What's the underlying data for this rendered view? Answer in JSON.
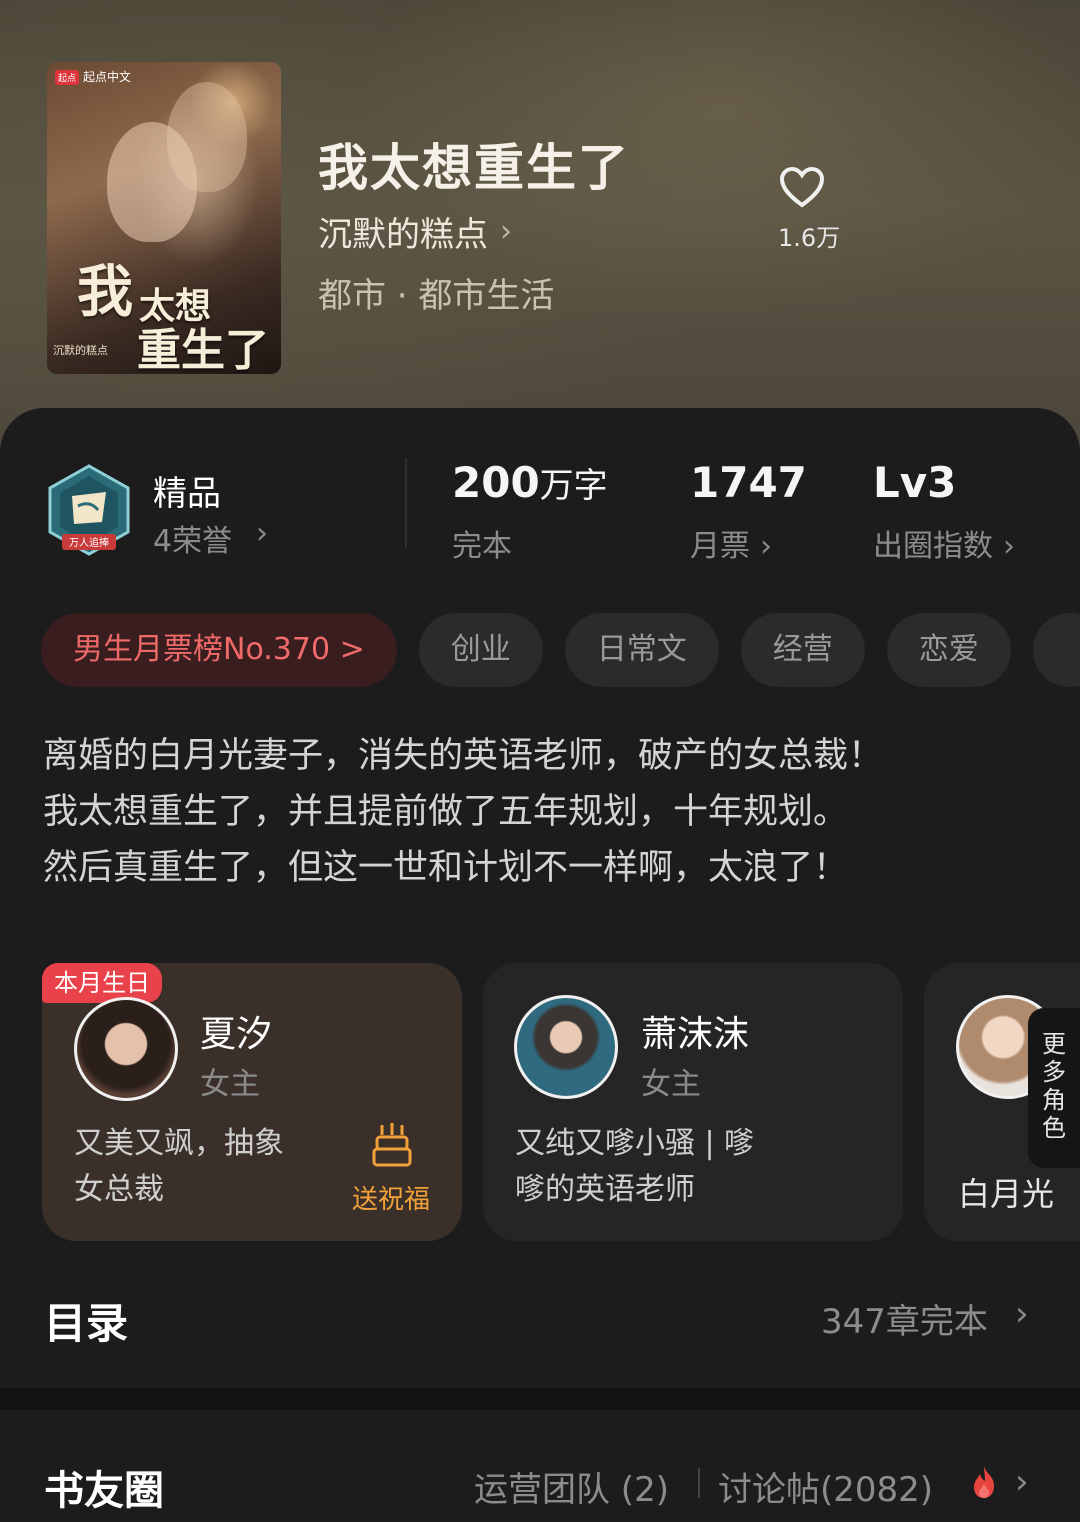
{
  "book": {
    "title": "我太想重生了",
    "author": "沉默的糕点",
    "genre": "都市 · 都市生活",
    "cover": {
      "badge_logo": "起点",
      "badge_text": "起点中文",
      "title_line1": "我",
      "title_line2": "太想",
      "title_line3": "重生了",
      "author_small": "沉默的糕点"
    }
  },
  "quality": {
    "badge_text": "万人追捧",
    "title": "精品",
    "honors": "4荣誉"
  },
  "stats": [
    {
      "value": "200",
      "unit": "万字",
      "label": "完本"
    },
    {
      "value": "1747",
      "unit": "",
      "label": "月票"
    },
    {
      "value": "Lv3",
      "unit": "",
      "label": "出圈指数"
    }
  ],
  "tags": {
    "rank": "男生月票榜No.370 >",
    "items": [
      "创业",
      "日常文",
      "经营",
      "恋爱"
    ]
  },
  "intro": [
    "离婚的白月光妻子，消失的英语老师，破产的女总裁！",
    "我太想重生了，并且提前做了五年规划，十年规划。",
    "然后真重生了，但这一世和计划不一样啊，太浪了！"
  ],
  "characters": [
    {
      "badge": "本月生日",
      "name": "夏汐",
      "role": "女主",
      "desc_line1": "又美又飒，抽象",
      "desc_line2": "女总裁",
      "action": "送祝福"
    },
    {
      "name": "萧沫沫",
      "role": "女主",
      "desc_line1": "又纯又嗲小骚 | 嗲",
      "desc_line2": "嗲的英语老师",
      "likes": "1.6万"
    },
    {
      "name": "白月光"
    }
  ],
  "more_roles": [
    "更",
    "多",
    "角",
    "色"
  ],
  "toc": {
    "title": "目录",
    "summary": "347章完本"
  },
  "circle": {
    "title": "书友圈",
    "team": "运营团队 (2)",
    "posts": "讨论帖(2082)"
  },
  "colors": {
    "accent_red": "#f06a6a",
    "birthday_red": "#e9424a",
    "blessing_orange": "#f2a13a"
  }
}
